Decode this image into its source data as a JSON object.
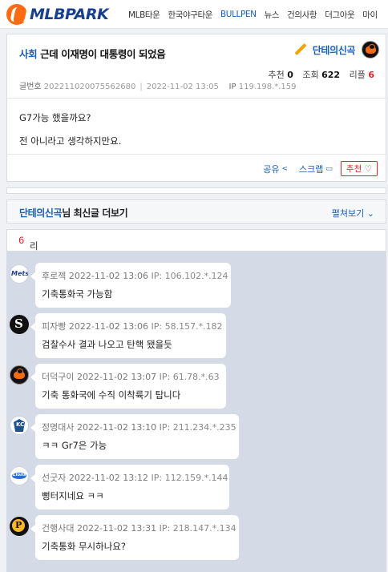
{
  "header": {
    "logo_text": "MLBPARK",
    "nav": [
      {
        "label": "MLB타운",
        "active": false
      },
      {
        "label": "한국야구타운",
        "active": false
      },
      {
        "label": "BULLPEN",
        "active": true
      },
      {
        "label": "뉴스",
        "active": false
      },
      {
        "label": "건의사항",
        "active": false
      },
      {
        "label": "더그아웃",
        "active": false
      },
      {
        "label": "마이",
        "active": false
      }
    ]
  },
  "post": {
    "category": "사회",
    "title": "근데 이재명이 대통령이 되었음",
    "author": "단테의신곡",
    "recommend_label": "추천",
    "recommend_count": "0",
    "views_label": "조회",
    "views_count": "622",
    "reply_label": "리플",
    "reply_count": "6",
    "number_label": "글번호",
    "number": "202211020075562680",
    "datetime": "2022-11-02 13:05",
    "ip_label": "IP",
    "ip": "119.198.*.159",
    "body": [
      "G7가능 했을까요?",
      "전 아니라고 생각하지만요."
    ],
    "share_label": "공유",
    "scrap_label": "스크랩",
    "recommend_button": "추천 ♡"
  },
  "latest": {
    "author": "단테의신곡",
    "suffix": "님 최신글 더보기",
    "expand_label": "펼쳐보기"
  },
  "replies": {
    "label": "리플",
    "count": "6",
    "items": [
      {
        "team": "mets-icon",
        "nick": "후로젝",
        "datetime": "2022-11-02 13:06",
        "ip": "IP: 106.102.*.124",
        "text": "기축통화국 가능함"
      },
      {
        "team": "white-sox-icon",
        "nick": "피자빵",
        "datetime": "2022-11-02 13:06",
        "ip": "IP: 58.157.*.182",
        "text": "검찰수사 결과 나오고 탄핵 됐을듯"
      },
      {
        "team": "orioles-icon",
        "nick": "더덕구이",
        "datetime": "2022-11-02 13:07",
        "ip": "IP: 61.78.*.63",
        "text": "기축 통화국에 수직 이착륙기 탑니다"
      },
      {
        "team": "royals-icon",
        "nick": "정명대사",
        "datetime": "2022-11-02 13:10",
        "ip": "IP: 211.234.*.235",
        "text": "ㅋㅋ Gr7은 가능"
      },
      {
        "team": "lions-icon",
        "nick": "선굿자",
        "datetime": "2022-11-02 13:12",
        "ip": "IP: 112.159.*.144",
        "text": "뻥터지네요 ㅋㅋ"
      },
      {
        "team": "pirates-icon",
        "nick": "건행사대",
        "datetime": "2022-11-02 13:31",
        "ip": "IP: 218.147.*.134",
        "text": "기축통화 무시하나요?"
      }
    ]
  }
}
